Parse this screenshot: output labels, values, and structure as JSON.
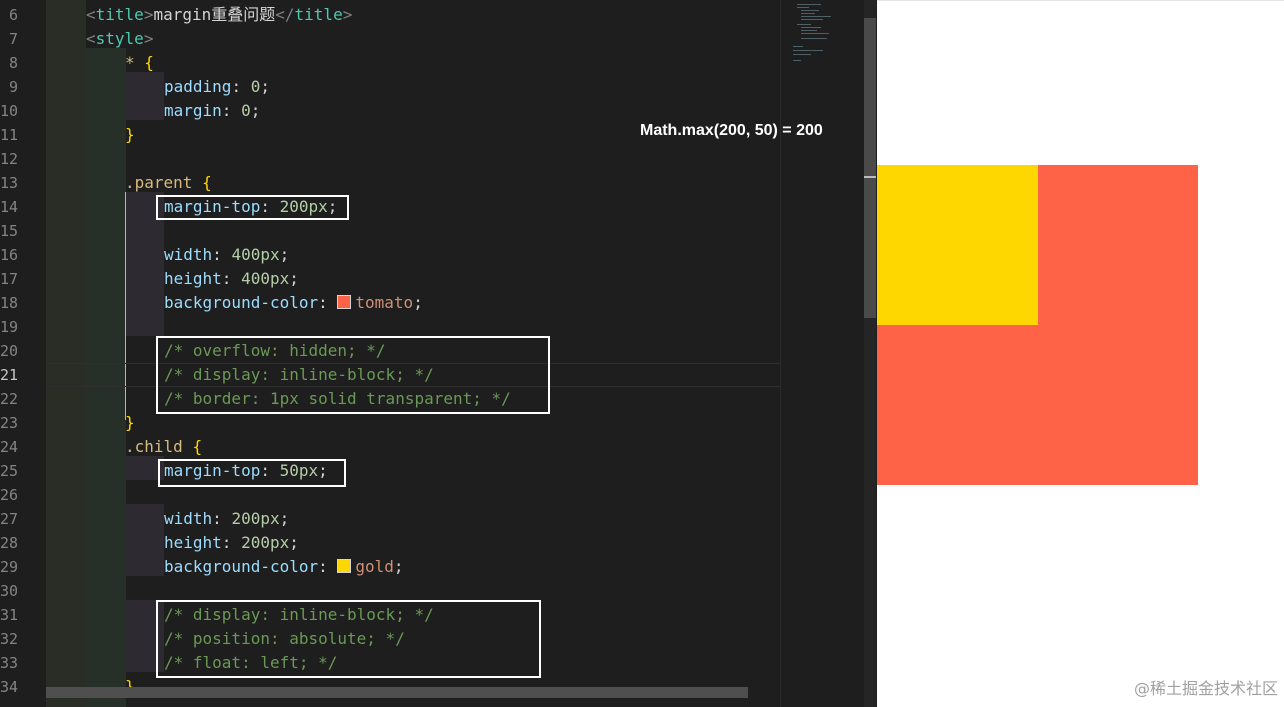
{
  "editor": {
    "line_numbers": [
      "6",
      "7",
      "8",
      "9",
      "10",
      "11",
      "12",
      "13",
      "14",
      "15",
      "16",
      "17",
      "18",
      "19",
      "20",
      "21",
      "22",
      "23",
      "24",
      "25",
      "26",
      "27",
      "28",
      "29",
      "30",
      "31",
      "32",
      "33",
      "34"
    ],
    "active_line": "21",
    "lines": {
      "l6_open": "<",
      "l6_tag": "title",
      "l6_close_bracket": ">",
      "l6_text": "margin重叠问题",
      "l6_end_open": "</",
      "l6_end_tag": "title",
      "l6_end_close": ">",
      "l7_open": "<",
      "l7_tag": "style",
      "l7_close": ">",
      "l8_sel": "*",
      "l8_brace": "{",
      "l9_prop": "padding",
      "l9_colon": ": ",
      "l9_num": "0",
      "l9_semi": ";",
      "l10_prop": "margin",
      "l10_colon": ": ",
      "l10_num": "0",
      "l10_semi": ";",
      "l11_brace": "}",
      "l13_sel": ".parent",
      "l13_brace": "{",
      "l14_prop": "margin-top",
      "l14_colon": ": ",
      "l14_num": "200px",
      "l14_semi": ";",
      "l16_prop": "width",
      "l16_colon": ": ",
      "l16_num": "400px",
      "l16_semi": ";",
      "l17_prop": "height",
      "l17_colon": ": ",
      "l17_num": "400px",
      "l17_semi": ";",
      "l18_prop": "background-color",
      "l18_colon": ": ",
      "l18_val": "tomato",
      "l18_semi": ";",
      "l20_cmt": "/* overflow: hidden; */",
      "l21_cmt": "/* display: inline-block; */",
      "l22_cmt": "/* border: 1px solid transparent; */",
      "l23_brace": "}",
      "l24_sel": ".child",
      "l24_brace": "{",
      "l25_prop": "margin-top",
      "l25_colon": ": ",
      "l25_num": "50px",
      "l25_semi": ";",
      "l27_prop": "width",
      "l27_colon": ": ",
      "l27_num": "200px",
      "l27_semi": ";",
      "l28_prop": "height",
      "l28_colon": ": ",
      "l28_num": "200px",
      "l28_semi": ";",
      "l29_prop": "background-color",
      "l29_colon": ": ",
      "l29_val": "gold",
      "l29_semi": ";",
      "l31_cmt": "/* display: inline-block; */",
      "l32_cmt": "/* position: absolute; */",
      "l33_cmt": "/* float: left; */",
      "l34_brace": "}"
    },
    "swatches": {
      "tomato": "#ff6347",
      "gold": "#ffd700"
    }
  },
  "annotation": "Math.max(200, 50) = 200",
  "preview": {
    "parent_color": "#ff6347",
    "child_color": "#ffd700"
  },
  "watermark": "@稀土掘金技术社区"
}
